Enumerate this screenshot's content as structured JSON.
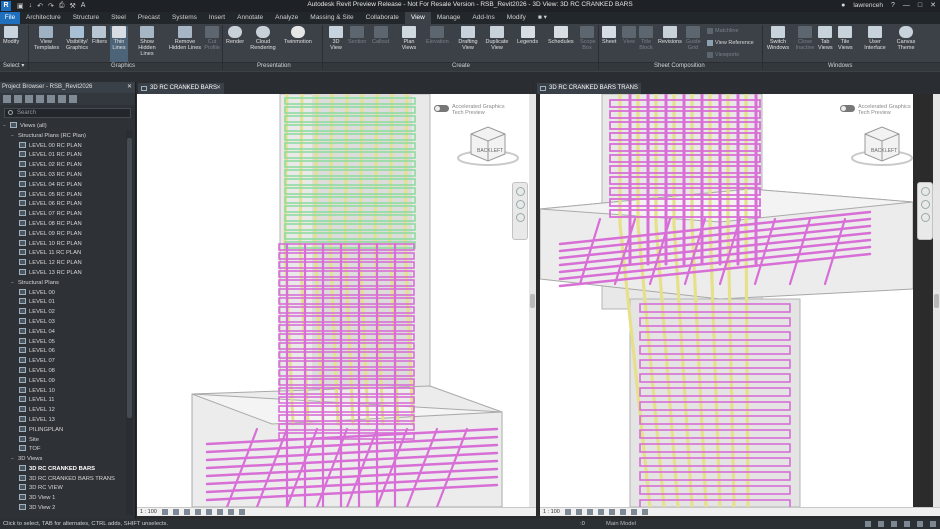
{
  "window": {
    "logo": "R",
    "title": "Autodesk Revit Preview Release - Not For Resale Version - RSB_Revit2026 - 3D View: 3D RC CRANKED BARS",
    "user": "lawrenceh",
    "help": "?",
    "qat": [
      "▣",
      "↓",
      "↶",
      "↷",
      "⎙",
      "⚒",
      "A"
    ]
  },
  "tabs": [
    "File",
    "Architecture",
    "Structure",
    "Steel",
    "Precast",
    "Systems",
    "Insert",
    "Annotate",
    "Analyze",
    "Massing & Site",
    "Collaborate",
    "View",
    "Manage",
    "Add-Ins",
    "Modify",
    "■ ▾"
  ],
  "active_tab": "View",
  "ribbon": {
    "modify": "Modify",
    "select": "Select ▾",
    "graphics": {
      "label": "Graphics",
      "buttons": [
        "View Templates",
        "Visibility/ Graphics",
        "Filters",
        "Thin Lines",
        "Show Hidden Lines",
        "Remove Hidden Lines",
        "Cut Profile"
      ]
    },
    "presentation": {
      "label": "Presentation",
      "buttons": [
        "Render",
        "Cloud Rendering",
        "Twinmotion"
      ]
    },
    "create": {
      "label": "Create",
      "buttons": [
        "3D View",
        "Section",
        "Callout",
        "Plan Views",
        "Elevation",
        "Drafting View",
        "Duplicate View",
        "Legends",
        "Schedules",
        "Scope Box"
      ]
    },
    "sheet_composition": {
      "label": "Sheet Composition",
      "buttons": [
        "Sheet",
        "View",
        "Title Block",
        "Revisions",
        "Guide Grid"
      ],
      "small": [
        "Matchline",
        "View Reference",
        "Viewports"
      ]
    },
    "windows": {
      "label": "Windows",
      "buttons": [
        "Switch Windows",
        "Close Inactive",
        "Tab Views",
        "Tile Views",
        "User Interface",
        "Canvas Theme"
      ]
    }
  },
  "project_browser": {
    "title": "Project Browser - RSB_Revit2026",
    "search_placeholder": "Search",
    "tree": [
      {
        "toggle": "−",
        "text": "Views (all)",
        "level": 0,
        "icon": true
      },
      {
        "toggle": "−",
        "text": "Structural Plans (RC Plan)",
        "level": 1,
        "icon": false
      },
      {
        "text": "LEVEL 00 RC PLAN",
        "level": 2
      },
      {
        "text": "LEVEL 01 RC PLAN",
        "level": 2
      },
      {
        "text": "LEVEL 02 RC PLAN",
        "level": 2
      },
      {
        "text": "LEVEL 03 RC PLAN",
        "level": 2
      },
      {
        "text": "LEVEL 04 RC PLAN",
        "level": 2
      },
      {
        "text": "LEVEL 05 RC PLAN",
        "level": 2
      },
      {
        "text": "LEVEL 06 RC PLAN",
        "level": 2
      },
      {
        "text": "LEVEL 07 RC PLAN",
        "level": 2
      },
      {
        "text": "LEVEL 08 RC PLAN",
        "level": 2
      },
      {
        "text": "LEVEL 09 RC PLAN",
        "level": 2
      },
      {
        "text": "LEVEL 10 RC PLAN",
        "level": 2
      },
      {
        "text": "LEVEL 11 RC PLAN",
        "level": 2
      },
      {
        "text": "LEVEL 12 RC PLAN",
        "level": 2
      },
      {
        "text": "LEVEL 13 RC PLAN",
        "level": 2
      },
      {
        "toggle": "−",
        "text": "Structural Plans",
        "level": 1,
        "icon": false
      },
      {
        "text": "LEVEL 00",
        "level": 2
      },
      {
        "text": "LEVEL 01",
        "level": 2
      },
      {
        "text": "LEVEL 02",
        "level": 2
      },
      {
        "text": "LEVEL 03",
        "level": 2
      },
      {
        "text": "LEVEL 04",
        "level": 2
      },
      {
        "text": "LEVEL 05",
        "level": 2
      },
      {
        "text": "LEVEL 06",
        "level": 2
      },
      {
        "text": "LEVEL 07",
        "level": 2
      },
      {
        "text": "LEVEL 08",
        "level": 2
      },
      {
        "text": "LEVEL 09",
        "level": 2
      },
      {
        "text": "LEVEL 10",
        "level": 2
      },
      {
        "text": "LEVEL 11",
        "level": 2
      },
      {
        "text": "LEVEL 12",
        "level": 2
      },
      {
        "text": "LEVEL 13",
        "level": 2
      },
      {
        "text": "PILINGPLAN",
        "level": 2
      },
      {
        "text": "Site",
        "level": 2
      },
      {
        "text": "TOF",
        "level": 2
      },
      {
        "toggle": "−",
        "text": "3D Views",
        "level": 1,
        "icon": false
      },
      {
        "text": "3D RC CRANKED BARS",
        "level": 2,
        "bold": true
      },
      {
        "text": "3D RC CRANKED BARS TRANS",
        "level": 2
      },
      {
        "text": "3D RC VIEW",
        "level": 2
      },
      {
        "text": "3D View 1",
        "level": 2
      },
      {
        "text": "3D View 2",
        "level": 2
      }
    ]
  },
  "views": {
    "left": {
      "tab": "3D RC CRANKED BARS",
      "scale": "1 : 100",
      "accel_line1": "Accelerated Graphics",
      "accel_line2": "Tech Preview",
      "cube_left": "BACK",
      "cube_right": "LEFT"
    },
    "right": {
      "tab": "3D RC CRANKED BARS TRANS",
      "scale": "1 : 100",
      "accel_line1": "Accelerated Graphics",
      "accel_line2": "Tech Preview",
      "cube_left": "BACK",
      "cube_right": "LEFT"
    }
  },
  "status": {
    "hint": "Click to select, TAB for alternates, CTRL adds, SHIFT unselects.",
    "zero": ":0",
    "model": "Main Model"
  },
  "colors": {
    "rebar_pink": "#d86fd6",
    "rebar_yellow": "#e6e08a",
    "rebar_green": "#8fdca0",
    "accent": "#1f6fbf"
  }
}
